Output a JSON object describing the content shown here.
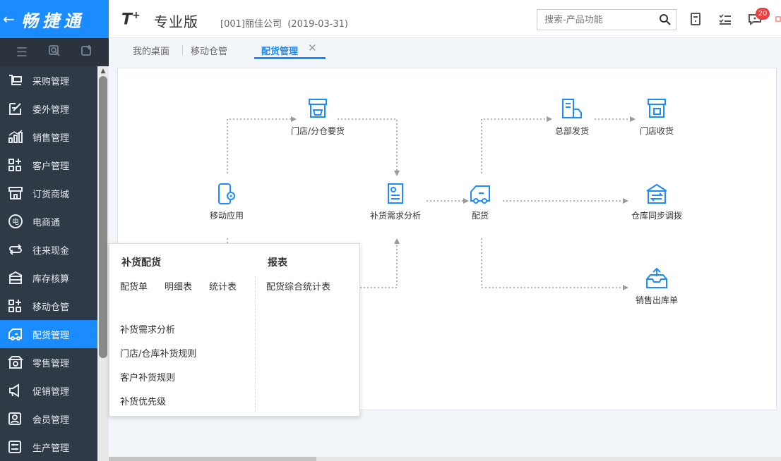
{
  "brand": {
    "back_icon": "←",
    "name": "畅捷通"
  },
  "header": {
    "logo_t": "T",
    "logo_plus": "+",
    "edition": "专业版",
    "company": "[001]丽佳公司",
    "date": "(2019-03-31)",
    "search_placeholder": "搜索-产品功能",
    "badge": "20"
  },
  "sidebar": {
    "items": [
      {
        "label": "采购管理",
        "icon": "cart-icon"
      },
      {
        "label": "委外管理",
        "icon": "edit-doc-icon"
      },
      {
        "label": "销售管理",
        "icon": "bar-chart-icon"
      },
      {
        "label": "客户管理",
        "icon": "grid-plus-icon"
      },
      {
        "label": "订货商城",
        "icon": "store-icon"
      },
      {
        "label": "电商通",
        "icon": "ecommerce-icon"
      },
      {
        "label": "往来现金",
        "icon": "exchange-icon"
      },
      {
        "label": "库存核算",
        "icon": "warehouse-icon"
      },
      {
        "label": "移动仓管",
        "icon": "grid-plus-icon"
      },
      {
        "label": "配货管理",
        "icon": "truck-icon",
        "active": true
      },
      {
        "label": "零售管理",
        "icon": "retail-icon"
      },
      {
        "label": "促销管理",
        "icon": "megaphone-icon"
      },
      {
        "label": "会员管理",
        "icon": "member-icon"
      },
      {
        "label": "生产管理",
        "icon": "production-icon"
      }
    ]
  },
  "tabs": [
    {
      "label": "我的桌面"
    },
    {
      "label": "移动仓管"
    },
    {
      "label": "配货管理",
      "active": true
    }
  ],
  "flow": {
    "store_request": "门店/分仓要货",
    "mobile_app": "移动应用",
    "replenish_analysis": "补货需求分析",
    "distribution": "配货",
    "hq_ship": "总部发货",
    "store_receive": "门店收货",
    "warehouse_transfer": "仓库同步调拨",
    "sales_outbound": "销售出库单"
  },
  "popup": {
    "col1_title": "补货配货",
    "col2_title": "报表",
    "links_row": [
      "配货单",
      "明细表",
      "统计表"
    ],
    "report_link": "配货综合统计表",
    "links_list": [
      "补货需求分析",
      "门店/仓库补货规则",
      "客户补货规则",
      "补货优先级"
    ]
  },
  "colors": {
    "brand": "#1a8cff",
    "sidebar": "#2f3a47",
    "badge": "#e84040"
  }
}
